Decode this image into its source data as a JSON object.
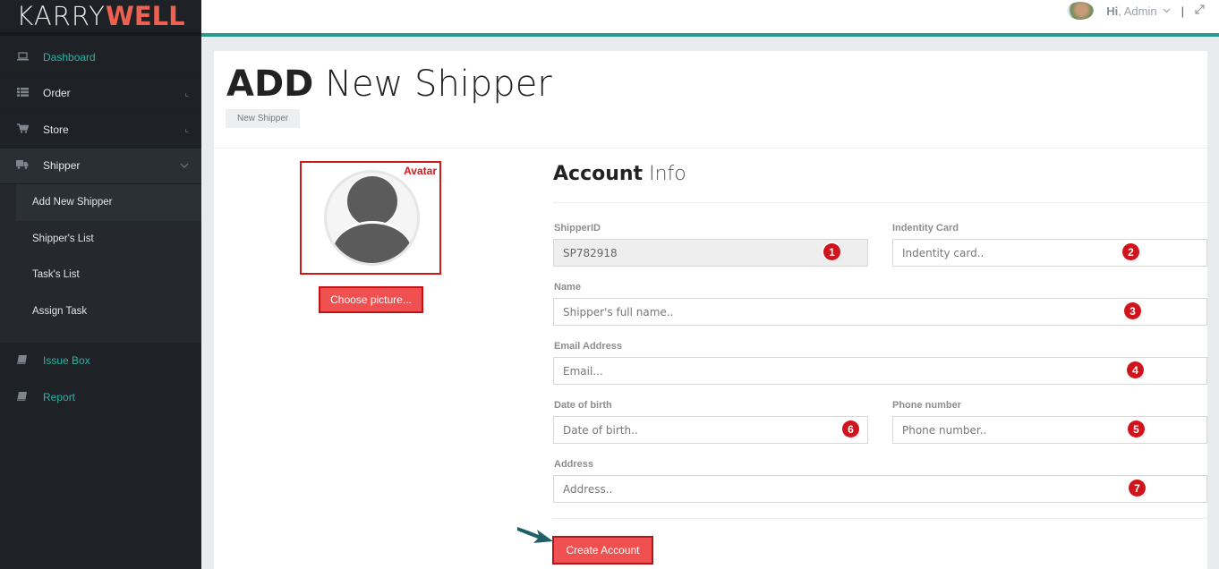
{
  "brand": {
    "part1": "KARRY",
    "part2": "WELL"
  },
  "sidebar": {
    "items": [
      {
        "label": "Dashboard",
        "icon": "laptop-icon"
      },
      {
        "label": "Order",
        "icon": "list-icon"
      },
      {
        "label": "Store",
        "icon": "cart-icon"
      },
      {
        "label": "Shipper",
        "icon": "truck-icon"
      },
      {
        "label": "Issue Box",
        "icon": "book-icon"
      },
      {
        "label": "Report",
        "icon": "book-icon"
      }
    ],
    "submenu": [
      "Add New Shipper",
      "Shipper's List",
      "Task's List",
      "Assign Task"
    ]
  },
  "header": {
    "greeting": "Hi",
    "user": ", Admin"
  },
  "page": {
    "title_bold": "ADD",
    "title_light": "New Shipper",
    "breadcrumb": "New Shipper"
  },
  "avatar": {
    "tag": "Avatar",
    "choose_label": "Choose picture..."
  },
  "form": {
    "title_bold": "Account",
    "title_light": "Info",
    "shipper_id": {
      "label": "ShipperID",
      "value": "SP782918",
      "marker": "1"
    },
    "identity": {
      "label": "Indentity Card",
      "placeholder": "Indentity card..",
      "marker": "2"
    },
    "name": {
      "label": "Name",
      "placeholder": "Shipper's full name..",
      "marker": "3"
    },
    "email": {
      "label": "Email Address",
      "placeholder": "Email...",
      "marker": "4"
    },
    "phone": {
      "label": "Phone number",
      "placeholder": "Phone number..",
      "marker": "5"
    },
    "dob": {
      "label": "Date of birth",
      "placeholder": "Date of birth..",
      "marker": "6"
    },
    "address": {
      "label": "Address",
      "placeholder": "Address..",
      "marker": "7"
    },
    "submit_label": "Create Account"
  },
  "colors": {
    "accent": "#229c8f",
    "button": "#f05050",
    "marker": "#d0141b",
    "sidebar": "#1e2226"
  }
}
